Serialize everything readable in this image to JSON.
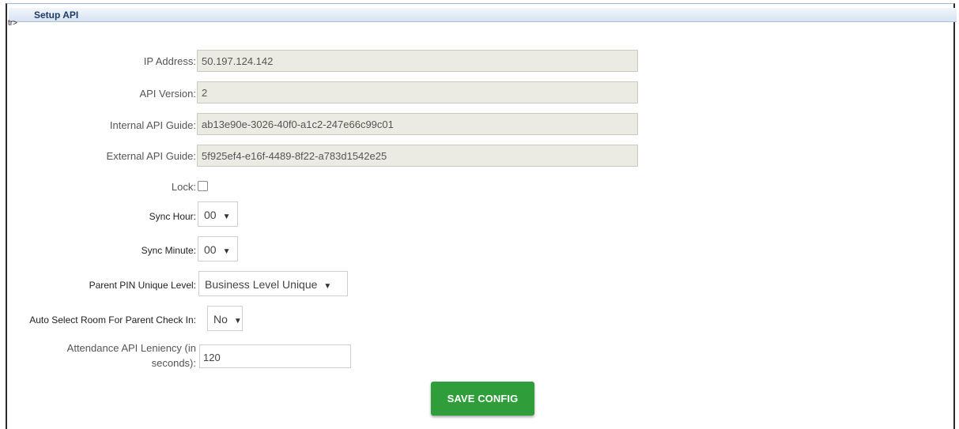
{
  "panel": {
    "title": "Setup API",
    "stray_text": "tr>"
  },
  "fields": {
    "ip_address": {
      "label": "IP Address:",
      "value": "50.197.124.142"
    },
    "api_version": {
      "label": "API Version:",
      "value": "2"
    },
    "internal_api_guide": {
      "label": "Internal API Guide:",
      "value": "ab13e90e-3026-40f0-a1c2-247e66c99c01"
    },
    "external_api_guide": {
      "label": "External API Guide:",
      "value": "5f925ef4-e16f-4489-8f22-a783d1542e25"
    },
    "lock": {
      "label": "Lock:",
      "checked": false
    },
    "sync_hour": {
      "label": "Sync Hour:",
      "value": "00"
    },
    "sync_minute": {
      "label": "Sync Minute:",
      "value": "00"
    },
    "parent_pin_unique_level": {
      "label": "Parent PIN Unique Level:",
      "value": "Business Level Unique"
    },
    "auto_select_room": {
      "label": "Auto Select Room For Parent Check In:",
      "value": "No"
    },
    "attendance_leniency": {
      "label_line1": "Attendance API Leniency (in",
      "label_line2": "seconds):",
      "value": "120"
    }
  },
  "actions": {
    "save_label": "SAVE CONFIG"
  },
  "icons": {
    "dropdown": "caret-down-icon",
    "arrow_glyph": "▼"
  },
  "colors": {
    "save_button": "#2f9e3a",
    "readonly_bg": "#ebebe4",
    "title_text": "#1f3b63"
  }
}
